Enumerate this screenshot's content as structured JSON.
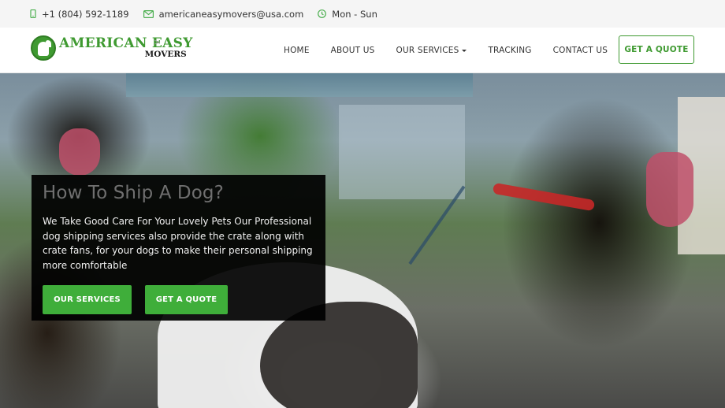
{
  "topbar": {
    "phone": "+1 (804) 592-1189",
    "email": "americaneasymovers@usa.com",
    "hours": "Mon - Sun",
    "icons": [
      "mobile-phone-icon",
      "envelope-icon",
      "clock-icon"
    ]
  },
  "header": {
    "logo_line1": "AMERICAN EASY",
    "logo_line2": "MOVERS",
    "logo_arrow": ">",
    "nav": [
      {
        "label": "HOME"
      },
      {
        "label": "ABOUT US"
      },
      {
        "label": "OUR SERVICES",
        "has_dropdown": true
      },
      {
        "label": "TRACKING"
      },
      {
        "label": "CONTACT US"
      }
    ],
    "cta_label": "GET A QUOTE"
  },
  "hero": {
    "title": "How To Ship A Dog?",
    "text": "We Take Good Care For Your Lovely Pets Our Professional dog shipping services also provide the crate along with crate fans, for your dogs to make their personal shipping more comfortable",
    "primary_button": "OUR SERVICES",
    "secondary_button": "GET A QUOTE"
  },
  "colors": {
    "accent": "#3fae3a",
    "logo_green": "#3f9a31",
    "topbar_bg": "#f5f5f5",
    "card_bg": "#000000"
  }
}
